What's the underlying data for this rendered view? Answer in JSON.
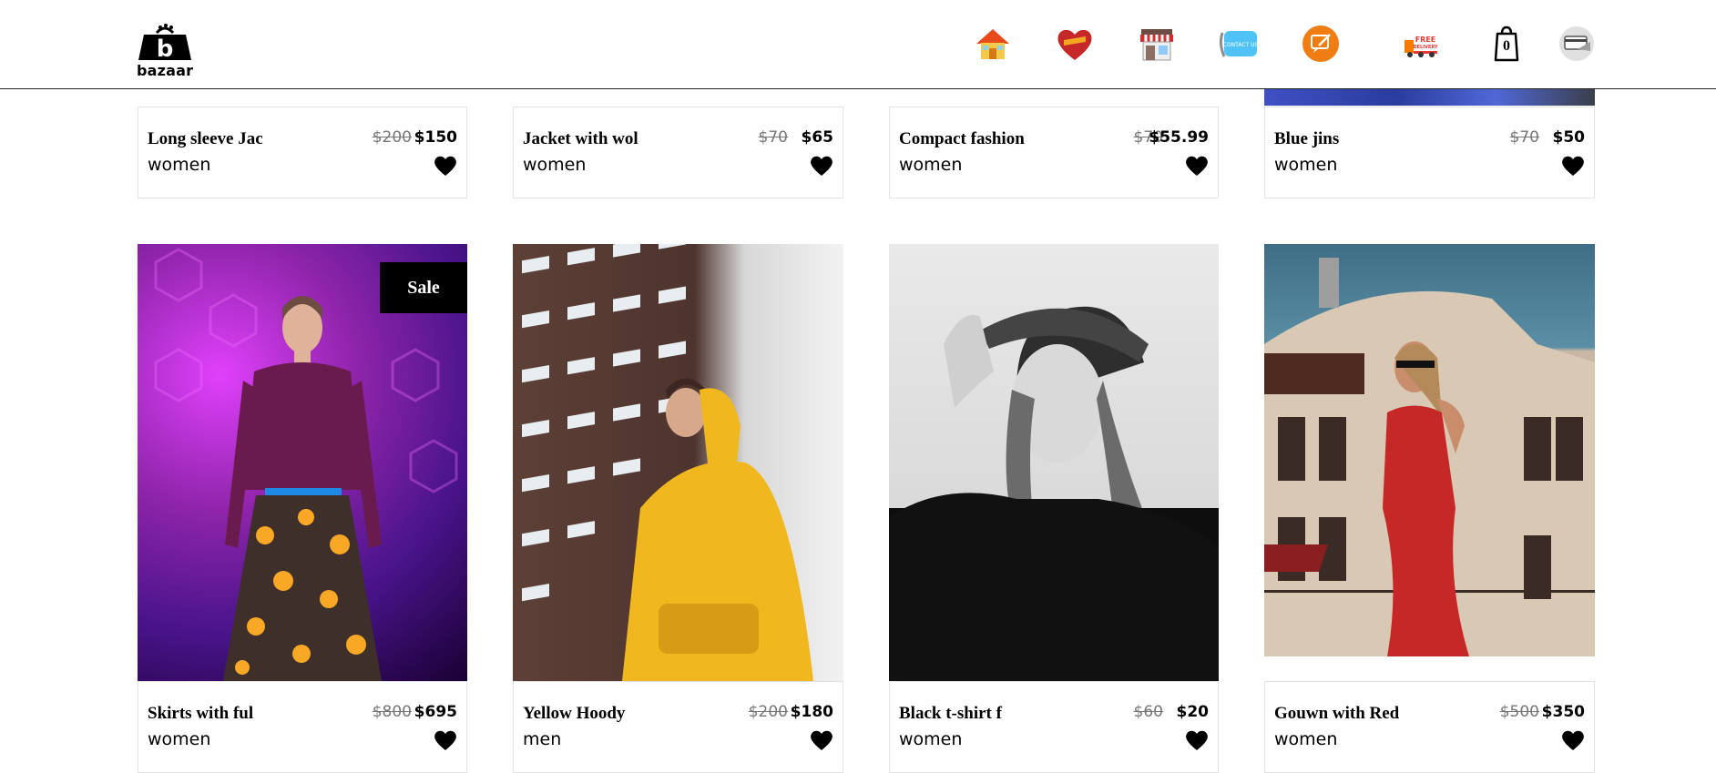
{
  "brand": {
    "name": "bazaar"
  },
  "nav": {
    "icons": [
      "home-icon",
      "heart-favorites-icon",
      "store-icon",
      "contact-us-icon",
      "chat-icon",
      "free-delivery-icon",
      "cart-icon",
      "user-card-icon"
    ],
    "cart_count": "0"
  },
  "products_top": [
    {
      "name": "Long sleeve Jac",
      "category": "women",
      "old_price": "$200",
      "price": "$150"
    },
    {
      "name": "Jacket with wol",
      "category": "women",
      "old_price": "$70",
      "price": "$65"
    },
    {
      "name": "Compact fashion",
      "category": "women",
      "old_price": "$70",
      "price": "$55.99"
    },
    {
      "name": "Blue jins",
      "category": "women",
      "old_price": "$70",
      "price": "$50"
    }
  ],
  "products_bottom": [
    {
      "name": "Skirts with ful",
      "category": "women",
      "old_price": "$800",
      "price": "$695",
      "badge": "Sale"
    },
    {
      "name": "Yellow Hoody",
      "category": "men",
      "old_price": "$200",
      "price": "$180"
    },
    {
      "name": "Black t-shirt f",
      "category": "women",
      "old_price": "$60",
      "price": "$20"
    },
    {
      "name": "Gouwn with Red",
      "category": "women",
      "old_price": "$500",
      "price": "$350"
    }
  ]
}
